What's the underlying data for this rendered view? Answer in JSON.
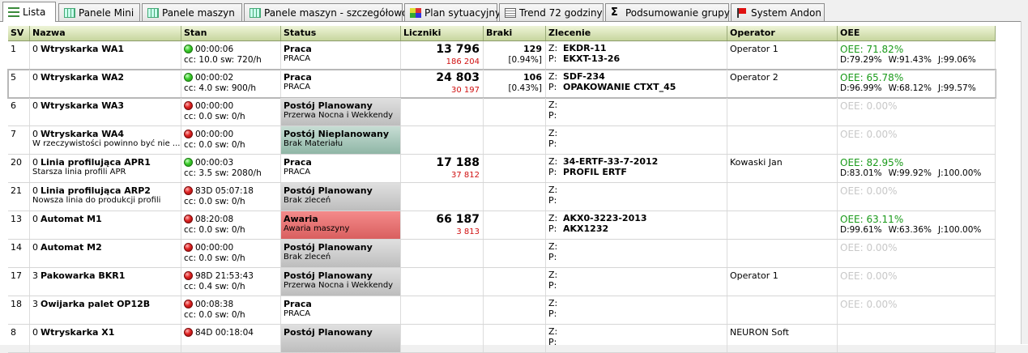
{
  "tabs": [
    {
      "label": "Lista",
      "icon": "list-icon",
      "active": true
    },
    {
      "label": "Panele Mini",
      "icon": "panel-icon"
    },
    {
      "label": "Panele maszyn",
      "icon": "panel-icon"
    },
    {
      "label": "Panele maszyn - szczegółowo",
      "icon": "panel-icon"
    },
    {
      "label": "Plan sytuacyjny",
      "icon": "map-icon"
    },
    {
      "label": "Trend 72 godziny",
      "icon": "trend-icon"
    },
    {
      "label": "Podsumowanie grupy",
      "icon": "sigma-icon"
    },
    {
      "label": "System Andon",
      "icon": "flag-icon"
    }
  ],
  "columns": [
    "SV",
    "Nazwa",
    "Stan",
    "Status",
    "Liczniki",
    "Braki",
    "Zlecenie",
    "Operator",
    "OEE"
  ],
  "colors": {
    "green_oee": "#1a9a1a",
    "red_counter": "#d01010",
    "awaria": "#e07070",
    "planowany": "#c8c8c8",
    "nieplanowany": "#a8c8bb"
  },
  "rows": [
    {
      "sv": "1",
      "num": "0",
      "name": "Wtryskarka WA1",
      "desc": "",
      "light": "green",
      "time": "00:00:06",
      "cc": "cc: 10.0 sw: 720/h",
      "status_title": "Praca",
      "status_sub": "PRACA",
      "status_type": "praca",
      "counter": "13 796",
      "counter_red": "186 204",
      "braki": "129",
      "braki_pct": "[0.94%]",
      "z": "EKDR-11",
      "p": "EKXT-13-26",
      "operator": "Operator 1",
      "oee": "OEE: 71.82%",
      "oee_d": "D:79.29%",
      "oee_w": "W:91.43%",
      "oee_j": "J:99.06%"
    },
    {
      "sv": "5",
      "num": "0",
      "name": "Wtryskarka WA2",
      "desc": "",
      "light": "green",
      "time": "00:00:02",
      "cc": "cc: 4.0 sw: 900/h",
      "status_title": "Praca",
      "status_sub": "PRACA",
      "status_type": "praca",
      "counter": "24 803",
      "counter_red": "30 197",
      "braki": "106",
      "braki_pct": "[0.43%]",
      "z": "SDF-234",
      "p": "OPAKOWANIE CTXT_45",
      "operator": "Operator 2",
      "oee": "OEE: 65.78%",
      "oee_d": "D:96.99%",
      "oee_w": "W:68.12%",
      "oee_j": "J:99.57%",
      "selected": true
    },
    {
      "sv": "6",
      "num": "0",
      "name": "Wtryskarka WA3",
      "desc": "",
      "light": "red",
      "time": "00:00:00",
      "cc": "cc: 0.0 sw: 0/h",
      "status_title": "Postój Planowany",
      "status_sub": "Przerwa Nocna i Wekkendy",
      "status_type": "plan",
      "counter": "",
      "counter_red": "",
      "braki": "",
      "braki_pct": "",
      "z": "",
      "p": "",
      "operator": "",
      "oee": "OEE: 0.00%",
      "oee_d": "",
      "oee_w": "",
      "oee_j": ""
    },
    {
      "sv": "7",
      "num": "0",
      "name": "Wtryskarka WA4",
      "desc": "W rzeczywistości powinno być nie ...",
      "light": "red",
      "time": "00:00:00",
      "cc": "cc: 0.0 sw: 0/h",
      "status_title": "Postój Nieplanowany",
      "status_sub": "Brak Materiału",
      "status_type": "nplan",
      "counter": "",
      "counter_red": "",
      "braki": "",
      "braki_pct": "",
      "z": "",
      "p": "",
      "operator": "",
      "oee": "OEE: 0.00%",
      "oee_d": "",
      "oee_w": "",
      "oee_j": ""
    },
    {
      "sv": "20",
      "num": "0",
      "name": "Linia profilująca APR1",
      "desc": "Starsza linia profili APR",
      "light": "green",
      "time": "00:00:03",
      "cc": "cc: 3.5 sw: 2080/h",
      "status_title": "Praca",
      "status_sub": "PRACA",
      "status_type": "praca",
      "counter": "17 188",
      "counter_red": "37 812",
      "braki": "",
      "braki_pct": "",
      "z": "34-ERTF-33-7-2012",
      "p": "PROFIL ERTF",
      "operator": "Kowaski Jan",
      "oee": "OEE: 82.95%",
      "oee_d": "D:83.01%",
      "oee_w": "W:99.92%",
      "oee_j": "J:100.00%"
    },
    {
      "sv": "21",
      "num": "0",
      "name": "Linia profilująca ARP2",
      "desc": "Nowsza linia do produkcji profili",
      "light": "red",
      "time": "83D 05:07:18",
      "cc": "cc: 0.0 sw: 0/h",
      "status_title": "Postój Planowany",
      "status_sub": "Brak zleceń",
      "status_type": "plan",
      "counter": "",
      "counter_red": "",
      "braki": "",
      "braki_pct": "",
      "z": "",
      "p": "",
      "operator": "",
      "oee": "OEE: 0.00%",
      "oee_d": "",
      "oee_w": "",
      "oee_j": ""
    },
    {
      "sv": "13",
      "num": "0",
      "name": "Automat M1",
      "desc": "",
      "light": "red",
      "time": "08:20:08",
      "cc": "cc: 0.0 sw: 0/h",
      "status_title": "Awaria",
      "status_sub": "Awaria maszyny",
      "status_type": "awaria",
      "counter": "66 187",
      "counter_red": "3 813",
      "braki": "",
      "braki_pct": "",
      "z": "AKX0-3223-2013",
      "p": "AKX1232",
      "operator": "",
      "oee": "OEE: 63.11%",
      "oee_d": "D:99.61%",
      "oee_w": "W:63.36%",
      "oee_j": "J:100.00%"
    },
    {
      "sv": "14",
      "num": "0",
      "name": "Automat M2",
      "desc": "",
      "light": "red",
      "time": "00:00:00",
      "cc": "cc: 0.0 sw: 0/h",
      "status_title": "Postój Planowany",
      "status_sub": "Brak zleceń",
      "status_type": "plan",
      "counter": "",
      "counter_red": "",
      "braki": "",
      "braki_pct": "",
      "z": "",
      "p": "",
      "operator": "",
      "oee": "OEE: 0.00%",
      "oee_d": "",
      "oee_w": "",
      "oee_j": ""
    },
    {
      "sv": "17",
      "num": "3",
      "name": "Pakowarka BKR1",
      "desc": "",
      "light": "red",
      "time": "98D 21:53:43",
      "cc": "cc: 0.4 sw: 0/h",
      "status_title": "Postój Planowany",
      "status_sub": "Przerwa Nocna i Wekkendy",
      "status_type": "plan",
      "counter": "",
      "counter_red": "",
      "braki": "",
      "braki_pct": "",
      "z": "",
      "p": "",
      "operator": "Operator 1",
      "oee": "OEE: 0.00%",
      "oee_d": "",
      "oee_w": "",
      "oee_j": ""
    },
    {
      "sv": "18",
      "num": "3",
      "name": "Owijarka palet OP12B",
      "desc": "",
      "light": "red",
      "time": "00:08:38",
      "cc": "cc: 0.0 sw: 0/h",
      "status_title": "Praca",
      "status_sub": "PRACA",
      "status_type": "praca",
      "counter": "",
      "counter_red": "",
      "braki": "",
      "braki_pct": "",
      "z": "",
      "p": "",
      "operator": "",
      "oee": "OEE: 0.00%",
      "oee_d": "",
      "oee_w": "",
      "oee_j": ""
    },
    {
      "sv": "8",
      "num": "0",
      "name": "Wtryskarka X1",
      "desc": "",
      "light": "red",
      "time": "84D 00:18:04",
      "cc": "",
      "status_title": "Postój Planowany",
      "status_sub": "",
      "status_type": "plan",
      "counter": "",
      "counter_red": "",
      "braki": "",
      "braki_pct": "",
      "z": "",
      "p": "",
      "operator": "NEURON Soft",
      "oee": "",
      "oee_d": "",
      "oee_w": "",
      "oee_j": ""
    }
  ]
}
